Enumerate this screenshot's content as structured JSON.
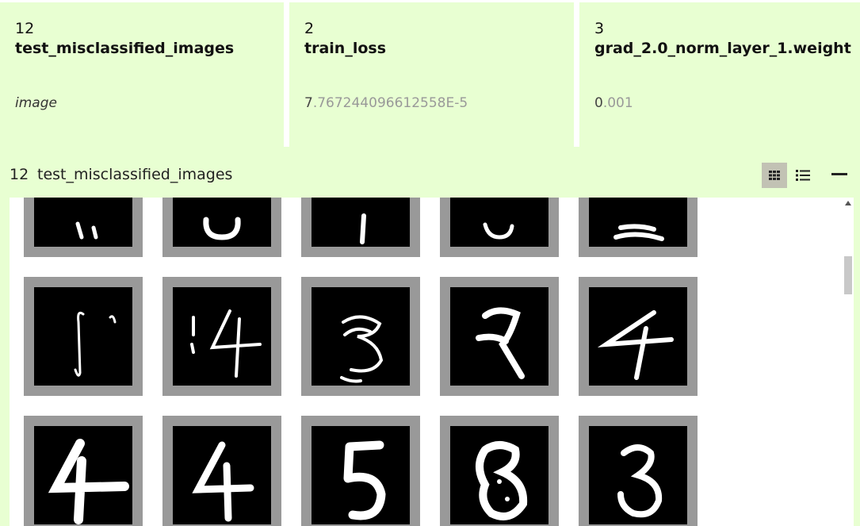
{
  "cards": [
    {
      "number": "12",
      "title": "test_misclassified_images",
      "value": "image"
    },
    {
      "number": "2",
      "title": "train_loss",
      "value_lead": "7",
      "value_rest": ".767244096612558E-5"
    },
    {
      "number": "3",
      "title": "grad_2.0_norm_layer_1.weight",
      "value_lead": "0",
      "value_rest": ".001"
    }
  ],
  "panel": {
    "number": "12",
    "title": "test_misclassified_images",
    "grid_icon": "grid-view-icon",
    "list_icon": "list-view-icon",
    "minimize_icon": "minimize-icon"
  },
  "images": {
    "row_partial": [
      "digit-partial-1",
      "digit-partial-2",
      "digit-partial-3",
      "digit-partial-4",
      "digit-partial-5"
    ],
    "row_middle": [
      "digit-noise-f",
      "digit-4-broken",
      "digit-scribble-3",
      "digit-7",
      "digit-4-thin"
    ],
    "row_bottom": [
      "digit-4-bold",
      "digit-4",
      "digit-5",
      "digit-8-blob",
      "digit-3"
    ]
  }
}
